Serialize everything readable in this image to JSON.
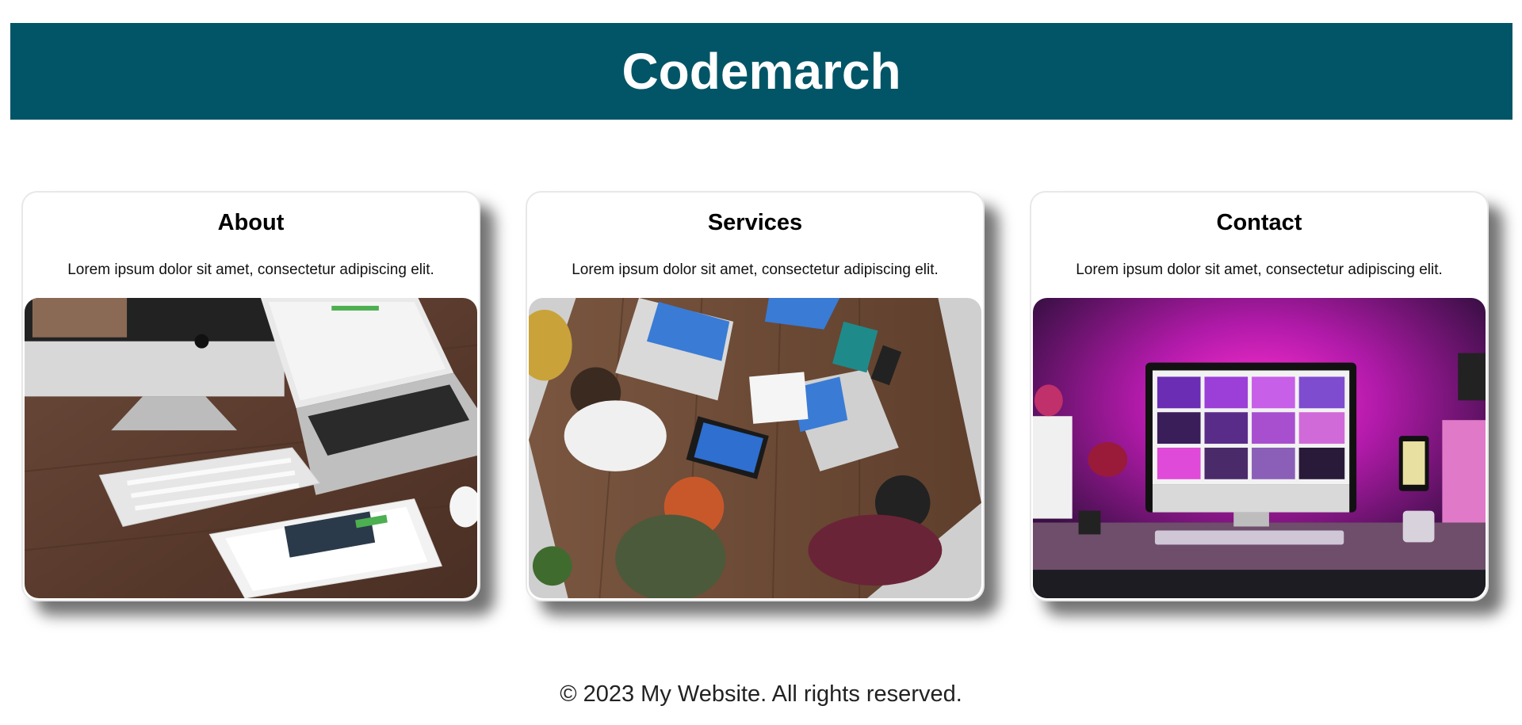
{
  "header": {
    "title": "Codemarch",
    "bg_color": "#025566"
  },
  "cards": [
    {
      "title": "About",
      "text": "Lorem ipsum dolor sit amet, consectetur adipiscing elit.",
      "image": "desk-with-imac-laptop-tablet"
    },
    {
      "title": "Services",
      "text": "Lorem ipsum dolor sit amet, consectetur adipiscing elit.",
      "image": "team-meeting-overhead"
    },
    {
      "title": "Contact",
      "text": "Lorem ipsum dolor sit amet, consectetur adipiscing elit.",
      "image": "purple-lit-workstation"
    }
  ],
  "footer": {
    "text": "© 2023 My Website. All rights reserved."
  }
}
